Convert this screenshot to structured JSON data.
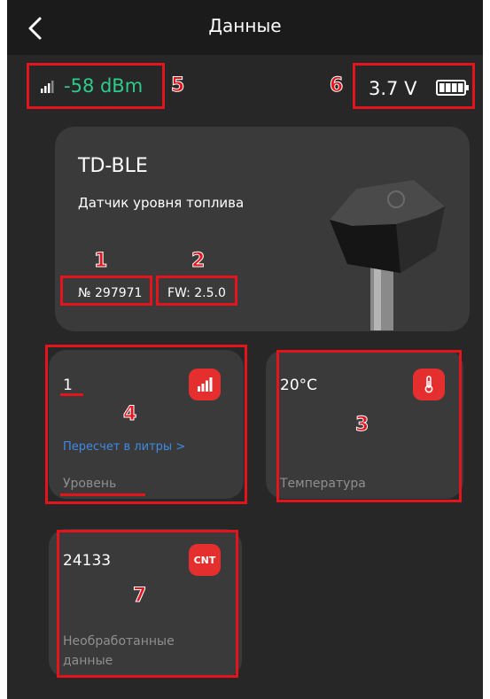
{
  "header": {
    "title": "Данные",
    "back_icon": "chevron-left-icon"
  },
  "status": {
    "signal_label": "-58 dBm",
    "voltage_label": "3.7 V",
    "signal_color": "#2ecb8a"
  },
  "device": {
    "name": "TD-BLE",
    "description": "Датчик уровня топлива",
    "serial": "№ 297971",
    "firmware": "FW: 2.5.0"
  },
  "tiles": {
    "level": {
      "value": "1",
      "link": "Пересчет в литры >",
      "label": "Уровень",
      "icon": "signal-bars-icon"
    },
    "temperature": {
      "value": "20°C",
      "label": "Температура",
      "icon": "thermometer-icon"
    },
    "raw": {
      "value": "24133",
      "button": "CNT",
      "label_line1": "Необработанные",
      "label_line2": "данные"
    }
  },
  "annotations": [
    "1",
    "2",
    "3",
    "4",
    "5",
    "6",
    "7"
  ],
  "colors": {
    "accent": "#e52f2f",
    "annotation": "#e3141c",
    "link": "#3f8ae6"
  }
}
